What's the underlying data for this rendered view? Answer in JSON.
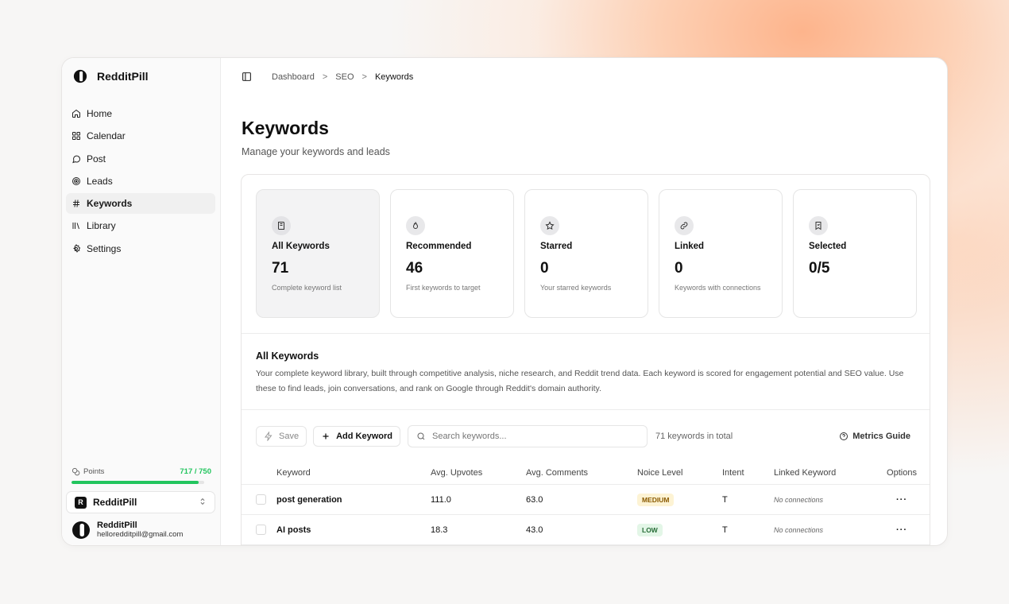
{
  "app": {
    "name": "RedditPill"
  },
  "sidebar": {
    "items": [
      {
        "label": "Home",
        "icon": "home-icon"
      },
      {
        "label": "Calendar",
        "icon": "grid-icon"
      },
      {
        "label": "Post",
        "icon": "chat-bubble-icon"
      },
      {
        "label": "Leads",
        "icon": "target-icon"
      },
      {
        "label": "Keywords",
        "icon": "hash-icon",
        "active": true
      },
      {
        "label": "Library",
        "icon": "library-icon"
      },
      {
        "label": "Settings",
        "icon": "gear-icon"
      }
    ],
    "points": {
      "label": "Points",
      "value_text": "717 / 750",
      "fraction": 0.956
    },
    "workspace": {
      "badge": "R",
      "name": "RedditPill"
    },
    "user": {
      "name": "RedditPill",
      "email": "helloredditpill@gmail.com"
    }
  },
  "breadcrumb": [
    "Dashboard",
    "SEO",
    "Keywords"
  ],
  "breadcrumb_sep": ">",
  "page": {
    "title": "Keywords",
    "subtitle": "Manage your keywords and leads"
  },
  "cards": [
    {
      "title": "All Keywords",
      "value": "71",
      "desc": "Complete keyword list",
      "icon": "book-icon",
      "active": true
    },
    {
      "title": "Recommended",
      "value": "46",
      "desc": "First keywords to target",
      "icon": "flame-icon"
    },
    {
      "title": "Starred",
      "value": "0",
      "desc": "Your starred keywords",
      "icon": "star-icon"
    },
    {
      "title": "Linked",
      "value": "0",
      "desc": "Keywords with connections",
      "icon": "link-icon"
    },
    {
      "title": "Selected",
      "value": "0/5",
      "desc": "",
      "icon": "bookmark-icon"
    }
  ],
  "section": {
    "title": "All Keywords",
    "desc": "Your complete keyword library, built through competitive analysis, niche research, and Reddit trend data. Each keyword is scored for engagement potential and SEO value. Use these to find leads, join conversations, and rank on Google through Reddit's domain authority."
  },
  "toolbar": {
    "save": "Save",
    "add": "Add Keyword",
    "search_placeholder": "Search keywords...",
    "total": "71 keywords in total",
    "metrics": "Metrics Guide"
  },
  "table": {
    "headers": [
      "Keyword",
      "Avg. Upvotes",
      "Avg. Comments",
      "Noice Level",
      "Intent",
      "Linked Keyword",
      "Options"
    ],
    "rows": [
      {
        "keyword": "post generation",
        "upvotes": "111.0",
        "comments": "63.0",
        "noise": "MEDIUM",
        "intent": "T",
        "linked": "No connections",
        "options": "···"
      },
      {
        "keyword": "AI posts",
        "upvotes": "18.3",
        "comments": "43.0",
        "noise": "LOW",
        "intent": "T",
        "linked": "No connections",
        "options": "···"
      }
    ]
  },
  "colors": {
    "accent_green": "#22c55e",
    "badge_medium": "#fdf3d4",
    "badge_low": "#e3f6e7"
  }
}
